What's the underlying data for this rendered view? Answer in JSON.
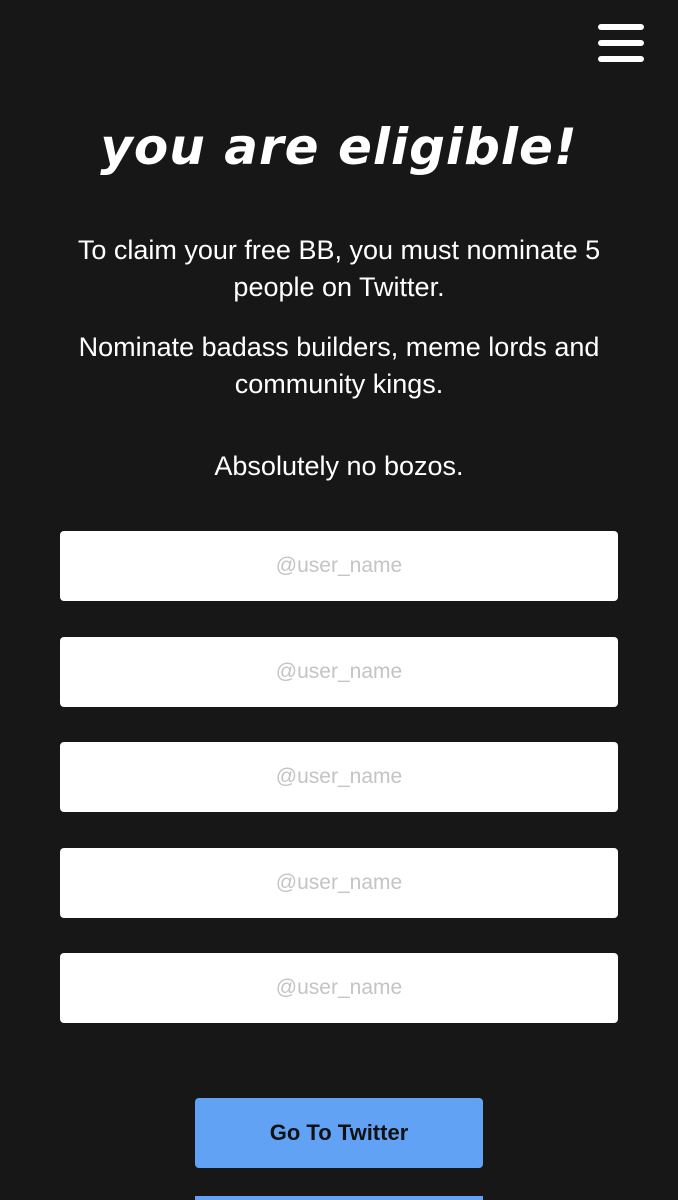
{
  "header": {
    "menu_icon": "hamburger-menu-icon"
  },
  "main": {
    "title": "you are eligible!",
    "paragraphs": [
      "To claim your free BB, you must nominate 5 people on Twitter.",
      "Nominate badass builders, meme lords and community kings.",
      "Absolutely no bozos."
    ],
    "nominee_fields": [
      {
        "placeholder": "@user_name",
        "value": ""
      },
      {
        "placeholder": "@user_name",
        "value": ""
      },
      {
        "placeholder": "@user_name",
        "value": ""
      },
      {
        "placeholder": "@user_name",
        "value": ""
      },
      {
        "placeholder": "@user_name",
        "value": ""
      }
    ],
    "go_button_label": "Go To Twitter"
  },
  "colors": {
    "background": "#171717",
    "text": "#ffffff",
    "input_background": "#ffffff",
    "placeholder": "#c4c4c4",
    "button": "#62a2f5"
  }
}
